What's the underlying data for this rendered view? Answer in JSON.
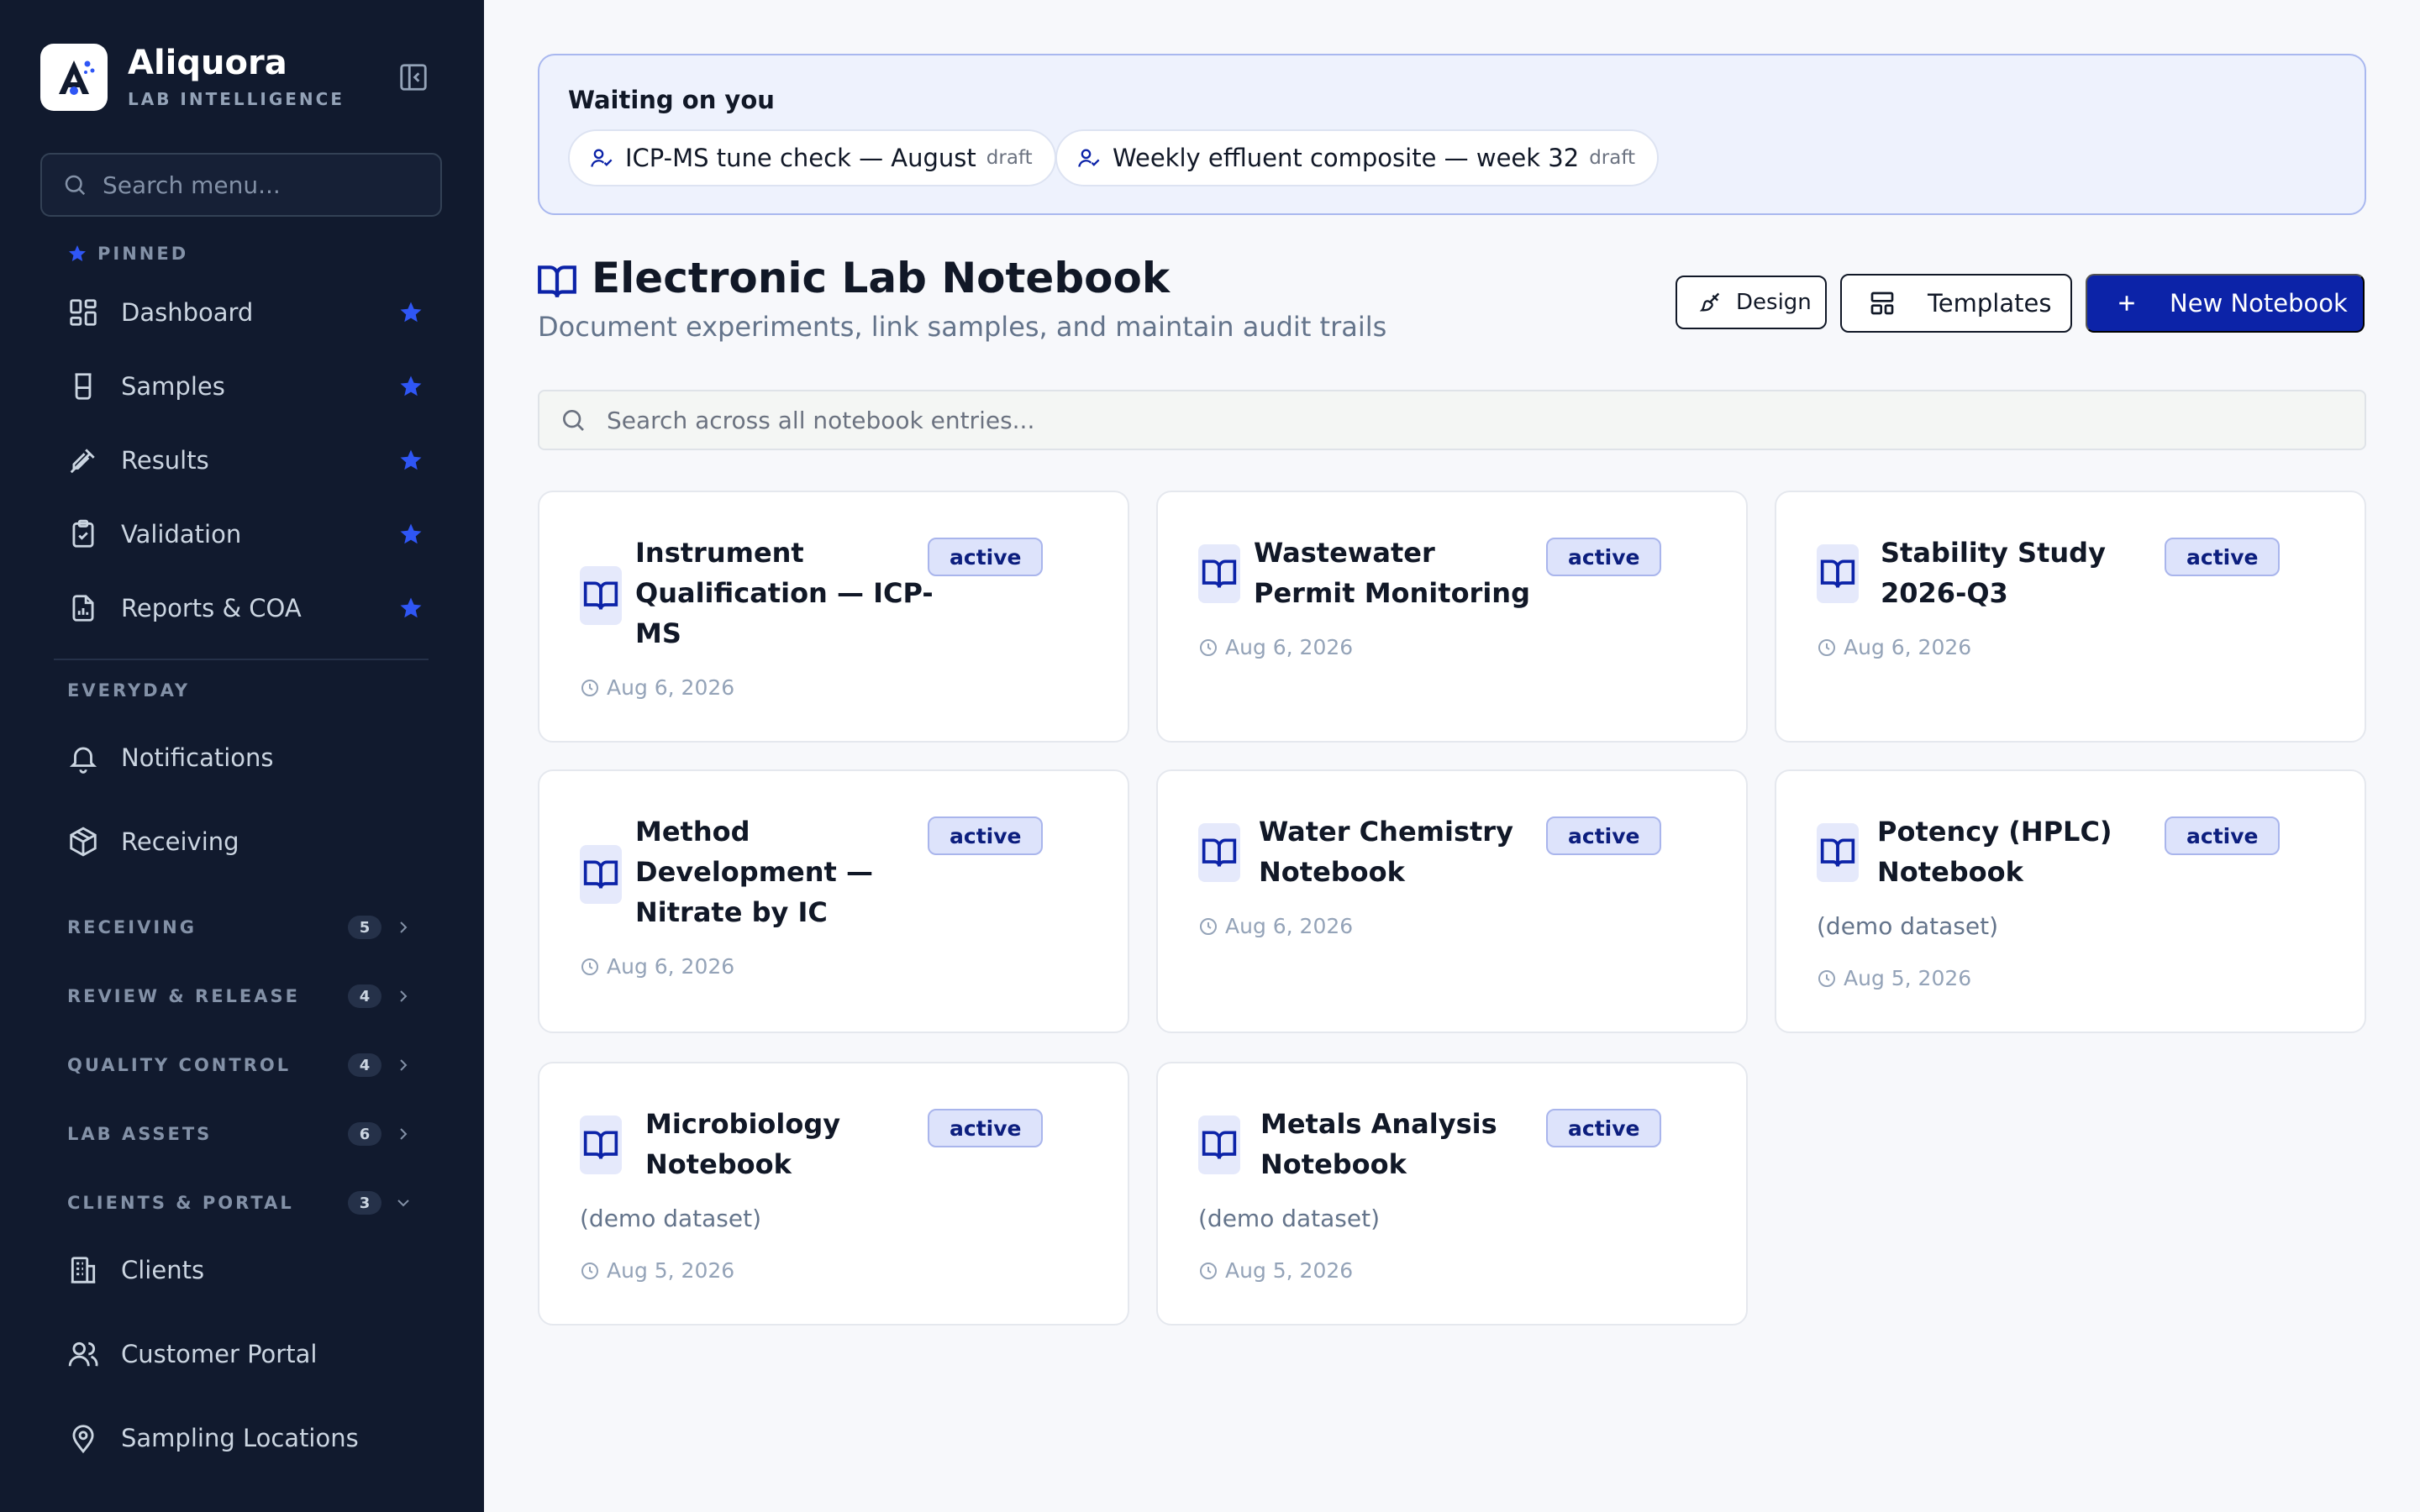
{
  "brand": {
    "name": "Aliquora",
    "subtitle": "LAB INTELLIGENCE"
  },
  "sidebar": {
    "search_placeholder": "Search menu...",
    "pinned_label": "PINNED",
    "pinned": [
      {
        "label": "Dashboard",
        "icon": "dashboard-icon"
      },
      {
        "label": "Samples",
        "icon": "beaker-icon"
      },
      {
        "label": "Results",
        "icon": "pipette-icon"
      },
      {
        "label": "Validation",
        "icon": "clipboard-check-icon"
      },
      {
        "label": "Reports & COA",
        "icon": "report-file-icon"
      }
    ],
    "everyday_label": "EVERYDAY",
    "everyday": [
      {
        "label": "Notifications",
        "icon": "bell-icon"
      },
      {
        "label": "Receiving",
        "icon": "package-icon"
      }
    ],
    "groups": [
      {
        "label": "RECEIVING",
        "count": "5",
        "expanded": false
      },
      {
        "label": "REVIEW & RELEASE",
        "count": "4",
        "expanded": false
      },
      {
        "label": "QUALITY CONTROL",
        "count": "4",
        "expanded": false
      },
      {
        "label": "LAB ASSETS",
        "count": "6",
        "expanded": false
      },
      {
        "label": "CLIENTS & PORTAL",
        "count": "3",
        "expanded": true
      }
    ],
    "clients_portal": [
      {
        "label": "Clients",
        "icon": "building-icon"
      },
      {
        "label": "Customer Portal",
        "icon": "users-icon"
      },
      {
        "label": "Sampling Locations",
        "icon": "map-pin-icon"
      }
    ]
  },
  "waiting": {
    "title": "Waiting on you",
    "items": [
      {
        "label": "ICP-MS tune check — August",
        "tag": "draft"
      },
      {
        "label": "Weekly effluent composite — week 32",
        "tag": "draft"
      }
    ]
  },
  "page": {
    "title": "Electronic Lab Notebook",
    "subtitle": "Document experiments, link samples, and maintain audit trails",
    "design_label": "Design",
    "templates_label": "Templates",
    "new_label": "New Notebook",
    "search_placeholder": "Search across all notebook entries..."
  },
  "notebooks": [
    {
      "title": "Instrument Qualification — ICP-MS",
      "status": "active",
      "desc": "",
      "date": "Aug 6, 2026"
    },
    {
      "title": "Wastewater Permit Monitoring",
      "status": "active",
      "desc": "",
      "date": "Aug 6, 2026"
    },
    {
      "title": "Stability Study 2026-Q3",
      "status": "active",
      "desc": "",
      "date": "Aug 6, 2026"
    },
    {
      "title": "Method Development — Nitrate by IC",
      "status": "active",
      "desc": "",
      "date": "Aug 6, 2026"
    },
    {
      "title": "Water Chemistry Notebook",
      "status": "active",
      "desc": "",
      "date": "Aug 6, 2026"
    },
    {
      "title": "Potency (HPLC) Notebook",
      "status": "active",
      "desc": "(demo dataset)",
      "date": "Aug 5, 2026"
    },
    {
      "title": "Microbiology Notebook",
      "status": "active",
      "desc": "(demo dataset)",
      "date": "Aug 5, 2026"
    },
    {
      "title": "Metals Analysis Notebook",
      "status": "active",
      "desc": "(demo dataset)",
      "date": "Aug 5, 2026"
    }
  ],
  "colors": {
    "sidebar_bg": "#111a2e",
    "accent": "#0c23a8",
    "pin_star": "#2f56f5",
    "badge_bg": "#dde3fb"
  }
}
